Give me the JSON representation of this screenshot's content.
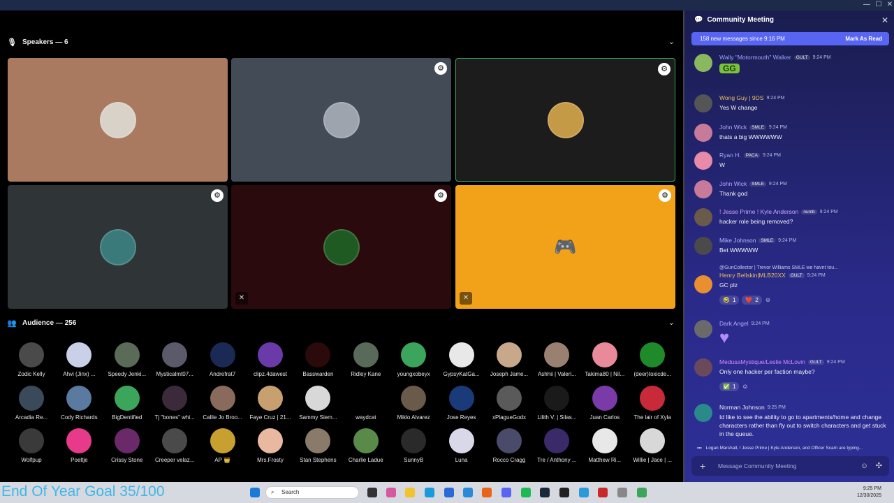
{
  "window": {
    "min": "—",
    "max": "☐",
    "close": "✕"
  },
  "speakers": {
    "header": "Speakers — 6",
    "tiles": [
      {
        "bg": "#a97a60",
        "avatar": "#d8d2c8"
      },
      {
        "bg": "#434b56",
        "avatar": "#9da4ae"
      },
      {
        "bg": "#1c1c1c",
        "avatar": "#c59a46"
      },
      {
        "bg": "#2f3436",
        "avatar": "#3a7a7a"
      },
      {
        "bg": "#2a0a0c",
        "avatar": "#1f5a22"
      },
      {
        "bg": "#f2a218",
        "avatar": "#f2a218"
      }
    ]
  },
  "audience": {
    "header": "Audience — 256",
    "members": [
      {
        "name": "Zodic Kelly",
        "color": "#4a4a4a"
      },
      {
        "name": "Ahvi (Jinx) ...",
        "color": "#c9d0e8"
      },
      {
        "name": "Speedy Jenki...",
        "color": "#5a6b58"
      },
      {
        "name": "Mysticalmt07...",
        "color": "#5b5a6a"
      },
      {
        "name": "Andrefrat7",
        "color": "#1b2a55"
      },
      {
        "name": "clipz.4dawest",
        "color": "#6a3aa8"
      },
      {
        "name": "Basswarden",
        "color": "#2a0a0a"
      },
      {
        "name": "Ridley Kane",
        "color": "#5a6a5a"
      },
      {
        "name": "youngxobeyx",
        "color": "#3ba55c"
      },
      {
        "name": "GypsyKatGa...",
        "color": "#e8e8e8"
      },
      {
        "name": "Joseph Jame...",
        "color": "#c8a88a"
      },
      {
        "name": "Ashhii | Valeri...",
        "color": "#9a8070"
      },
      {
        "name": "Takima80 | Nil...",
        "color": "#e88a9a"
      },
      {
        "name": "(deer)toxicde...",
        "color": "#1e8a2a"
      },
      {
        "name": "Arcadia Re...",
        "color": "#3a4a5a"
      },
      {
        "name": "Cody Richards",
        "color": "#5a7aa0"
      },
      {
        "name": "BigDentified",
        "color": "#3ba55c"
      },
      {
        "name": "Tj \"bones\" whi...",
        "color": "#3a2a3a"
      },
      {
        "name": "Callie Jo Broo...",
        "color": "#8a6a5a"
      },
      {
        "name": "Faye Cruz | 21...",
        "color": "#c8a070"
      },
      {
        "name": "Sammy Siem...",
        "color": "#d8d8d8"
      },
      {
        "name": "waydcat",
        "color": "#000000"
      },
      {
        "name": "Miklo Alvarez",
        "color": "#6a5a4a"
      },
      {
        "name": "Jose Reyes",
        "color": "#1a3a7a"
      },
      {
        "name": "xPlagueGodx",
        "color": "#5a5a5a"
      },
      {
        "name": "Lilith V. | Silas...",
        "color": "#1a1a1a"
      },
      {
        "name": "Juan Carlos",
        "color": "#7a3aa8"
      },
      {
        "name": "The lair of Xyla",
        "color": "#c82a3a"
      },
      {
        "name": "Wolfpup",
        "color": "#3a3a3a"
      },
      {
        "name": "Poeltje",
        "color": "#e83a8a"
      },
      {
        "name": "Crissy Stone",
        "color": "#6a2a6a"
      },
      {
        "name": "Creeper velaz...",
        "color": "#4a4a4a"
      },
      {
        "name": "AP 👑",
        "color": "#c8a030"
      },
      {
        "name": "Mrs.Frosty",
        "color": "#e8b8a0"
      },
      {
        "name": "Stan Stephens",
        "color": "#8a7a6a"
      },
      {
        "name": "Charlie Ladue",
        "color": "#5a8a4a"
      },
      {
        "name": "SunnyB",
        "color": "#2a2a2a"
      },
      {
        "name": "Luna",
        "color": "#d8d8e8"
      },
      {
        "name": "Rocco Cragg",
        "color": "#4a4a6a"
      },
      {
        "name": "Tre / Anthony ...",
        "color": "#3a2a6a"
      },
      {
        "name": "Matthew Ri...",
        "color": "#e8e8e8"
      },
      {
        "name": "Willie | Jace | ...",
        "color": "#d8d8d8"
      }
    ]
  },
  "overlay": {
    "goal": "End Of Year Goal 35/100"
  },
  "taskbar": {
    "search": "Search",
    "time": "9:25 PM",
    "date": "12/30/2025"
  },
  "chat": {
    "title": "Community Meeting",
    "new_messages": "158 new messages since 9:16 PM",
    "mark_read": "Mark As Read",
    "messages": [
      {
        "name": "Wally \"Motormouth\" Walker",
        "tag": "GULT",
        "time": "9:24 PM",
        "text": "GG",
        "color": "#9aa3ff",
        "avatar": "#8ab860"
      },
      {
        "name": "Wong Guy | 9DS",
        "tag": "",
        "time": "9:24 PM",
        "text": "Yes W change",
        "color": "#e8c060",
        "avatar": "#555555"
      },
      {
        "name": "John Wick",
        "tag": "SMLE",
        "time": "9:24 PM",
        "text": "thats a big WWWWWW",
        "color": "#b8a8ff",
        "avatar": "#c87a9a"
      },
      {
        "name": "Ryan H.",
        "tag": "PACA",
        "time": "9:24 PM",
        "text": "W",
        "color": "#a8a8ff",
        "avatar": "#e88aaa"
      },
      {
        "name": "John Wick",
        "tag": "SMLE",
        "time": "9:24 PM",
        "text": "Thank god",
        "color": "#b8a8ff",
        "avatar": "#c87a9a"
      },
      {
        "name": "! Jesse Prime ! Kyle Anderson",
        "tag": "numb",
        "time": "9:24 PM",
        "text": "hacker role being removed?",
        "color": "#c8a8ff",
        "avatar": "#6a5a4a"
      },
      {
        "name": "Mike Johnson",
        "tag": "SMLE",
        "time": "9:24 PM",
        "text": "Bet WWWWW",
        "color": "#b8b8ff",
        "avatar": "#4a4a4a"
      },
      {
        "name": "Henry Bellskin|MLB20XX",
        "tag": "GULT",
        "time": "9:24 PM",
        "text": "GC plz",
        "color": "#e8c060",
        "avatar": "#e89030",
        "reply": "@GunCollector | Trevor Williams  SMLE  we havnt tou..."
      },
      {
        "name": "Dark Angel",
        "tag": "",
        "time": "9:24 PM",
        "text": "",
        "color": "#b8a8ff",
        "avatar": "#6a6a6a"
      },
      {
        "name": "MedusaMystique/Leslie McLovin",
        "tag": "GULT",
        "time": "9:24 PM",
        "text": "Only one hacker per faction maybe?",
        "color": "#d88aff",
        "avatar": "#6a4a5a"
      },
      {
        "name": "Norman Johnson",
        "tag": "",
        "time": "9:25 PM",
        "text": "Id like to see the ability to go to apartments/home and change characters rather than fly out to switch characters and get stuck in the queue.",
        "color": "#e8e8f0",
        "avatar": "#2a8a8a"
      }
    ],
    "reactions": [
      {
        "emoji": "🤣",
        "count": "1"
      },
      {
        "emoji": "❤️",
        "count": "2"
      }
    ],
    "reaction_check": {
      "emoji": "✅",
      "count": "1"
    },
    "typing": "Logan Marshall, ! Jesse Prime | Kyle Anderson, and Officer Scarn are typing...",
    "input_placeholder": "Message Community Meeting"
  }
}
